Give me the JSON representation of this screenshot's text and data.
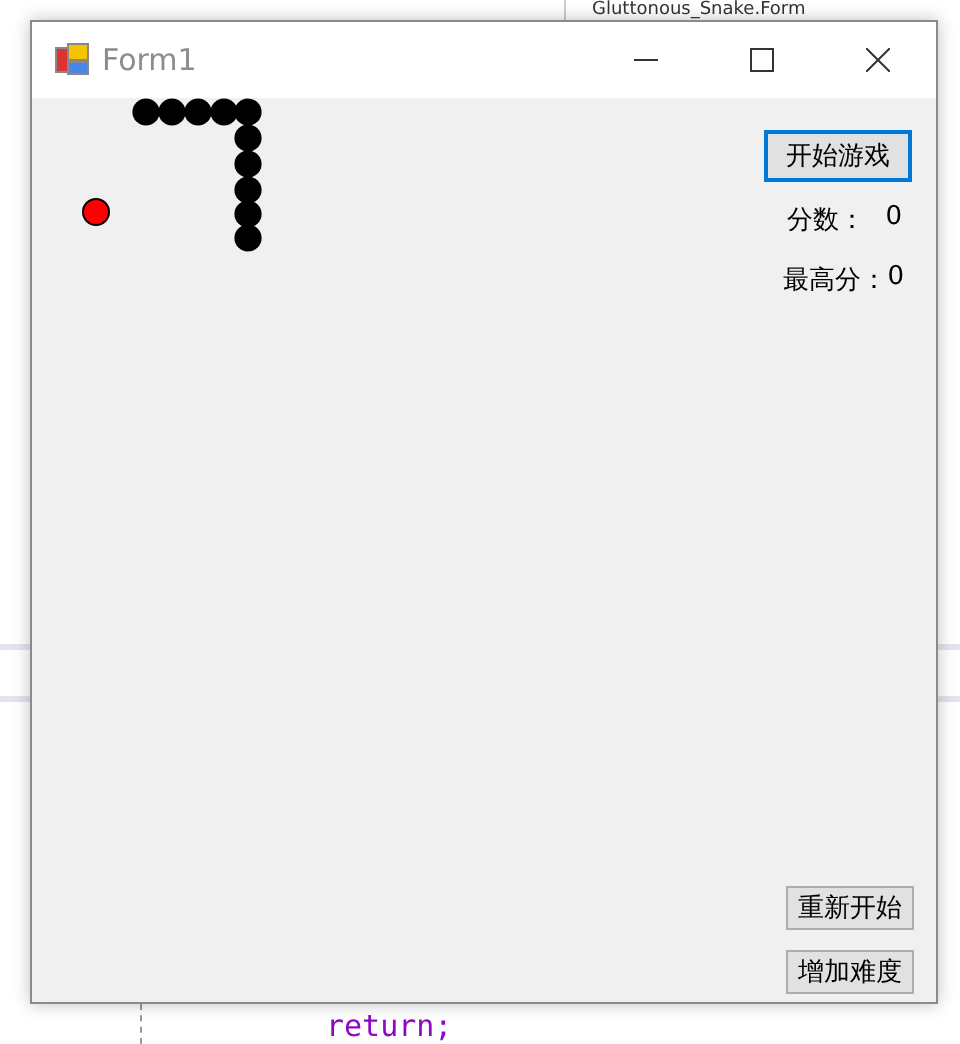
{
  "editor": {
    "tab": "Gluttonous_Snake.Form",
    "code_line": "return;"
  },
  "window": {
    "title": "Form1"
  },
  "start_button": {
    "label": "开始游戏",
    "focused": true
  },
  "score": {
    "label": "分数：",
    "value": "0"
  },
  "high_score": {
    "label": "最高分：",
    "value": "0"
  },
  "bottom_buttons": [
    {
      "label": "重新开始",
      "focused": false
    },
    {
      "label": "增加难度",
      "focused": false
    }
  ]
}
